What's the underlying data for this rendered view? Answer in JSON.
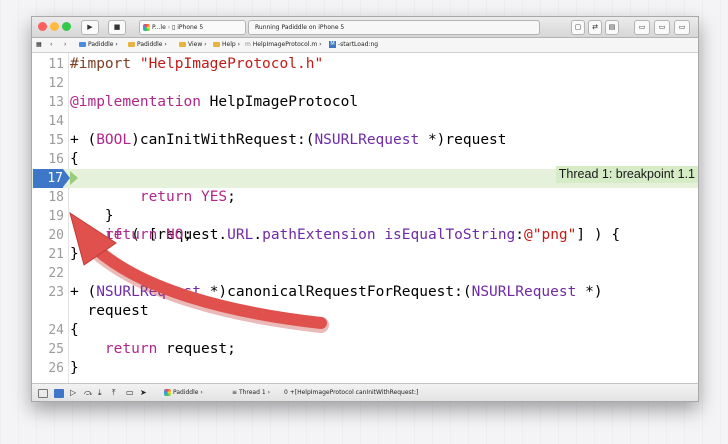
{
  "toolbar": {
    "run_icon": "play-icon",
    "stop_icon": "stop-icon",
    "scheme_name": "P...le",
    "device": "iPhone 5",
    "status": "Running Padiddle on iPhone 5",
    "icons": [
      "bubble-icon",
      "back-forward-icon",
      "layout-icon",
      "panel-left-icon",
      "panel-bottom-icon",
      "panel-right-icon"
    ]
  },
  "jumpbar": {
    "crumbs": [
      "Padiddle",
      "Padiddle",
      "View",
      "Help",
      "HelpImageProtocol.m",
      "-startLoad:ng"
    ]
  },
  "editor": {
    "lines": [
      {
        "n": "11",
        "text": "#import \"HelpImageProtocol.h\""
      },
      {
        "n": "12",
        "text": ""
      },
      {
        "n": "13",
        "text": "@implementation HelpImageProtocol"
      },
      {
        "n": "14",
        "text": ""
      },
      {
        "n": "15",
        "text": "+ (BOOL)canInitWithRequest:(NSURLRequest *)request"
      },
      {
        "n": "16",
        "text": "{"
      },
      {
        "n": "17",
        "text": "    if ( [request.URL.pathExtension isEqualToString:@\"png\"] ) {"
      },
      {
        "n": "18",
        "text": "        return YES;"
      },
      {
        "n": "19",
        "text": "    }"
      },
      {
        "n": "20",
        "text": "    return NO;"
      },
      {
        "n": "21",
        "text": "}"
      },
      {
        "n": "22",
        "text": ""
      },
      {
        "n": "23",
        "text": "+ (NSURLRequest *)canonicalRequestForRequest:(NSURLRequest *)"
      },
      {
        "n": "",
        "text": "  request"
      },
      {
        "n": "24",
        "text": "{"
      },
      {
        "n": "25",
        "text": "    return request;"
      },
      {
        "n": "26",
        "text": "}"
      }
    ],
    "breakpoint_line": "17",
    "thread_badge": "Thread 1: breakpoint 1.1"
  },
  "debugbar": {
    "crumbs": [
      "Padiddle",
      "Thread 1",
      "0 +[HelpImageProtocol canInitWithRequest:]"
    ]
  },
  "colors": {
    "breakpoint": "#3e77c8",
    "highlight": "#e5f1db",
    "thread_badge": "#d5ecc6",
    "arrow": "#e0514d",
    "keyword": "#b0268a",
    "preprocessor": "#7a3e22",
    "string": "#c41a16",
    "type": "#6f2aa8"
  }
}
